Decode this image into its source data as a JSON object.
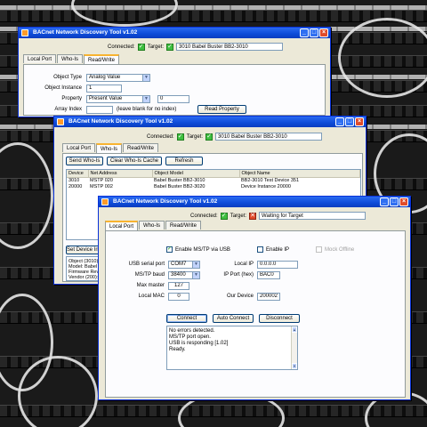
{
  "app": {
    "title": "BACnet Network Discovery Tool v1.02"
  },
  "status": {
    "connected_label": "Connected:",
    "target_label": "Target:",
    "target_value": "3010  Babel Buster BB2-3010",
    "target_waiting": "Waiting for Target",
    "connected_ok": "✓",
    "target_fail": "✕"
  },
  "tabs": [
    "Local Port",
    "Who-Is",
    "Read/Write"
  ],
  "win1": {
    "object_type_label": "Object Type",
    "object_type_value": "Analog Value",
    "object_instance_label": "Object Instance",
    "object_instance_value": "1",
    "property_label": "Property",
    "property_value": "Present Value",
    "property_index": "0",
    "array_index_label": "Array Index",
    "array_index_hint": "(leave blank for no index)",
    "read_property_label": "Read Property"
  },
  "win2": {
    "send_whois_label": "Send Who-Is",
    "clear_cache_label": "Clear Who-Is Cache",
    "refresh_label": "Refresh",
    "columns": [
      "Device",
      "Net Address",
      "Object Model",
      "Object Name"
    ],
    "rows": [
      [
        "3010",
        "MSTP 020",
        "Babel Buster BB2-3010",
        "BB2-3010 Test Device 351"
      ],
      [
        "20000",
        "MSTP 002",
        "Babel Buster BB2-3020",
        "Device Instance 20000"
      ]
    ],
    "set_device_label": "Set Device Ins",
    "info_lines": [
      "Object (3010)  BB2",
      "Model: Babel Bust",
      "Firmware Rev: 3.",
      "Vendor (200): Co"
    ]
  },
  "win3": {
    "enable_mstp_label": "Enable MS/TP via USB",
    "enable_ip_label": "Enable IP",
    "mock_offline_label": "Mock Offline",
    "usb_port_label": "USB serial port",
    "usb_port_value": "COM7",
    "baud_label": "MS/TP baud",
    "baud_value": "38400",
    "max_master_label": "Max master",
    "max_master_value": "127",
    "local_mac_label": "Local MAC",
    "local_mac_value": "0",
    "local_ip_label": "Local IP",
    "local_ip_value": "0.0.0.0",
    "ip_port_label": "IP Port (hex)",
    "ip_port_value": "BAC0",
    "our_device_label": "Our Device",
    "our_device_value": "200002",
    "connect_label": "Connect",
    "auto_connect_label": "Auto Connect",
    "disconnect_label": "Disconnect",
    "log": [
      "No errors detected.",
      "MS/TP port open.",
      "USB is responding [1.02]",
      "Ready."
    ]
  }
}
